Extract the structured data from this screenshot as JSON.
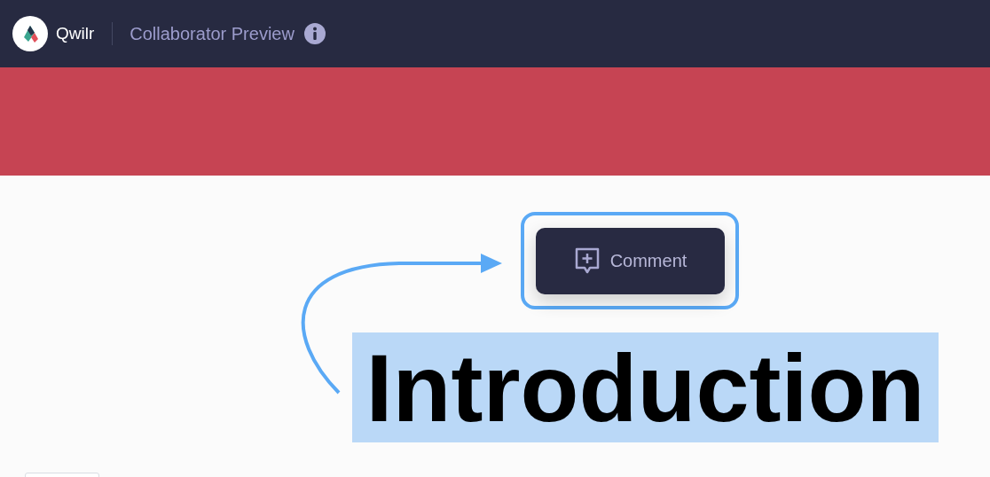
{
  "header": {
    "logo_text": "Qwilr",
    "title": "Collaborator Preview"
  },
  "comment_button": {
    "label": "Comment",
    "focused": true
  },
  "heading": {
    "text": "Introduction",
    "selected": true
  }
}
